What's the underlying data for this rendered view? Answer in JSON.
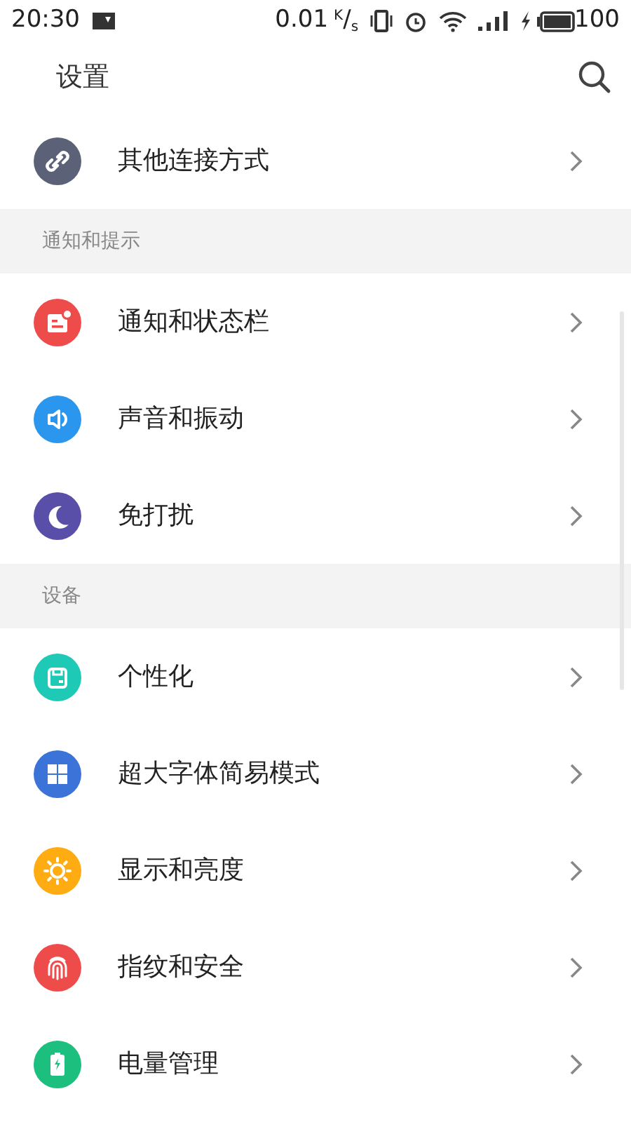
{
  "status_bar": {
    "time": "20:30",
    "speed": "0.01",
    "speed_unit": "$^{K}$/$_{s}$",
    "battery": "100"
  },
  "header": {
    "title": "设置"
  },
  "sections": [
    {
      "items": [
        {
          "label": "其他连接方式",
          "kind": "link",
          "color": "#5b6278"
        }
      ]
    },
    {
      "title": "通知和提示",
      "items": [
        {
          "label": "通知和状态栏",
          "kind": "notice",
          "color": "#ee4b4b"
        },
        {
          "label": "声音和振动",
          "kind": "sound",
          "color": "#2a96ee"
        },
        {
          "label": "免打扰",
          "kind": "moon",
          "color": "#5a4fa8"
        }
      ]
    },
    {
      "title": "设备",
      "items": [
        {
          "label": "个性化",
          "kind": "theme",
          "color": "#1ec9b5"
        },
        {
          "label": "超大字体简易模式",
          "kind": "grid",
          "color": "#3b73d9"
        },
        {
          "label": "显示和亮度",
          "kind": "sun",
          "color": "#ffac12"
        },
        {
          "label": "指纹和安全",
          "kind": "finger",
          "color": "#ee4b4b"
        },
        {
          "label": "电量管理",
          "kind": "battery",
          "color": "#1cbf7e"
        }
      ]
    }
  ]
}
